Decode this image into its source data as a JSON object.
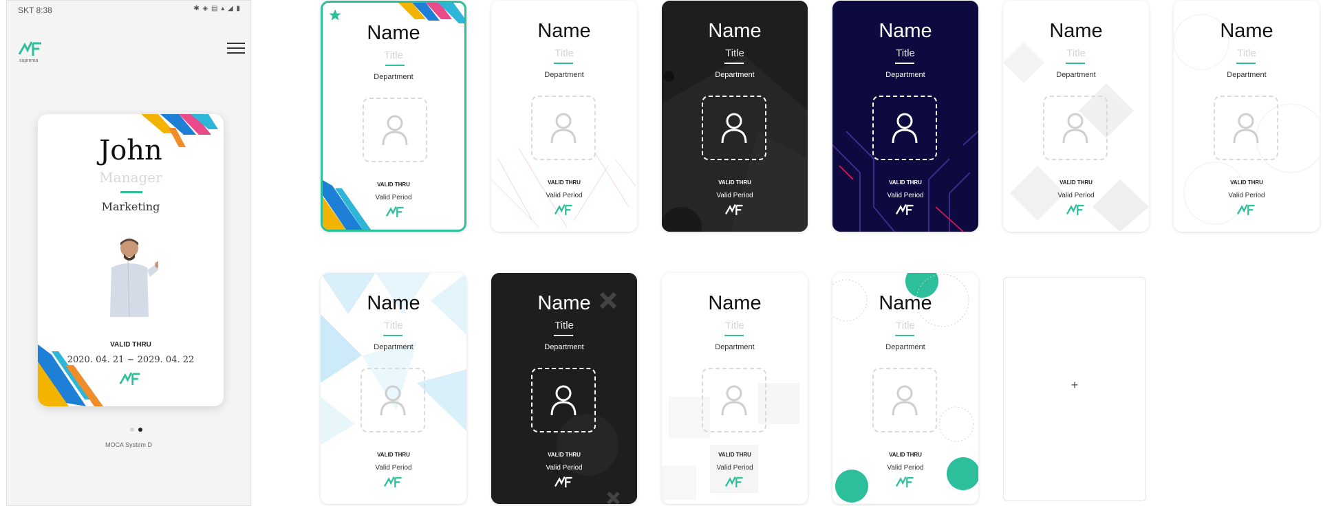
{
  "status": {
    "carrier_time": "SKT 8:38",
    "icons": "✱ ◈ ▤ ▴ ◢ ▮"
  },
  "app": {
    "logo_text": "suprema",
    "menu_icon": "hamburger-icon"
  },
  "preview": {
    "name": "John",
    "title": "Manager",
    "department": "Marketing",
    "valid_label": "VALID THRU",
    "valid_dates": "2020. 04. 21 ~ 2029. 04. 22",
    "pager_pages": 2,
    "pager_active": 1,
    "footer": "MOCA System D"
  },
  "template_labels": {
    "name": "Name",
    "title": "Title",
    "department": "Department",
    "valid_label": "VALID THRU",
    "valid_period": "Valid Period"
  },
  "templates": [
    {
      "theme": "white",
      "decor": "stripes",
      "selected": true
    },
    {
      "theme": "white",
      "decor": "lines",
      "selected": false
    },
    {
      "theme": "dark",
      "decor": "geometric",
      "selected": false
    },
    {
      "theme": "navy",
      "decor": "circuit",
      "selected": false
    },
    {
      "theme": "white",
      "decor": "diamonds",
      "selected": false
    },
    {
      "theme": "white",
      "decor": "pattern",
      "selected": false
    },
    {
      "theme": "white",
      "decor": "triangles",
      "selected": false
    },
    {
      "theme": "dark",
      "decor": "x-shapes",
      "selected": false
    },
    {
      "theme": "white",
      "decor": "squares",
      "selected": false
    },
    {
      "theme": "white",
      "decor": "circles",
      "selected": false
    }
  ],
  "add_card": {
    "label": "+"
  },
  "colors": {
    "accent": "#2dbf9c",
    "dark_card": "#1e1e1e",
    "navy_card": "#0c0a3e"
  }
}
